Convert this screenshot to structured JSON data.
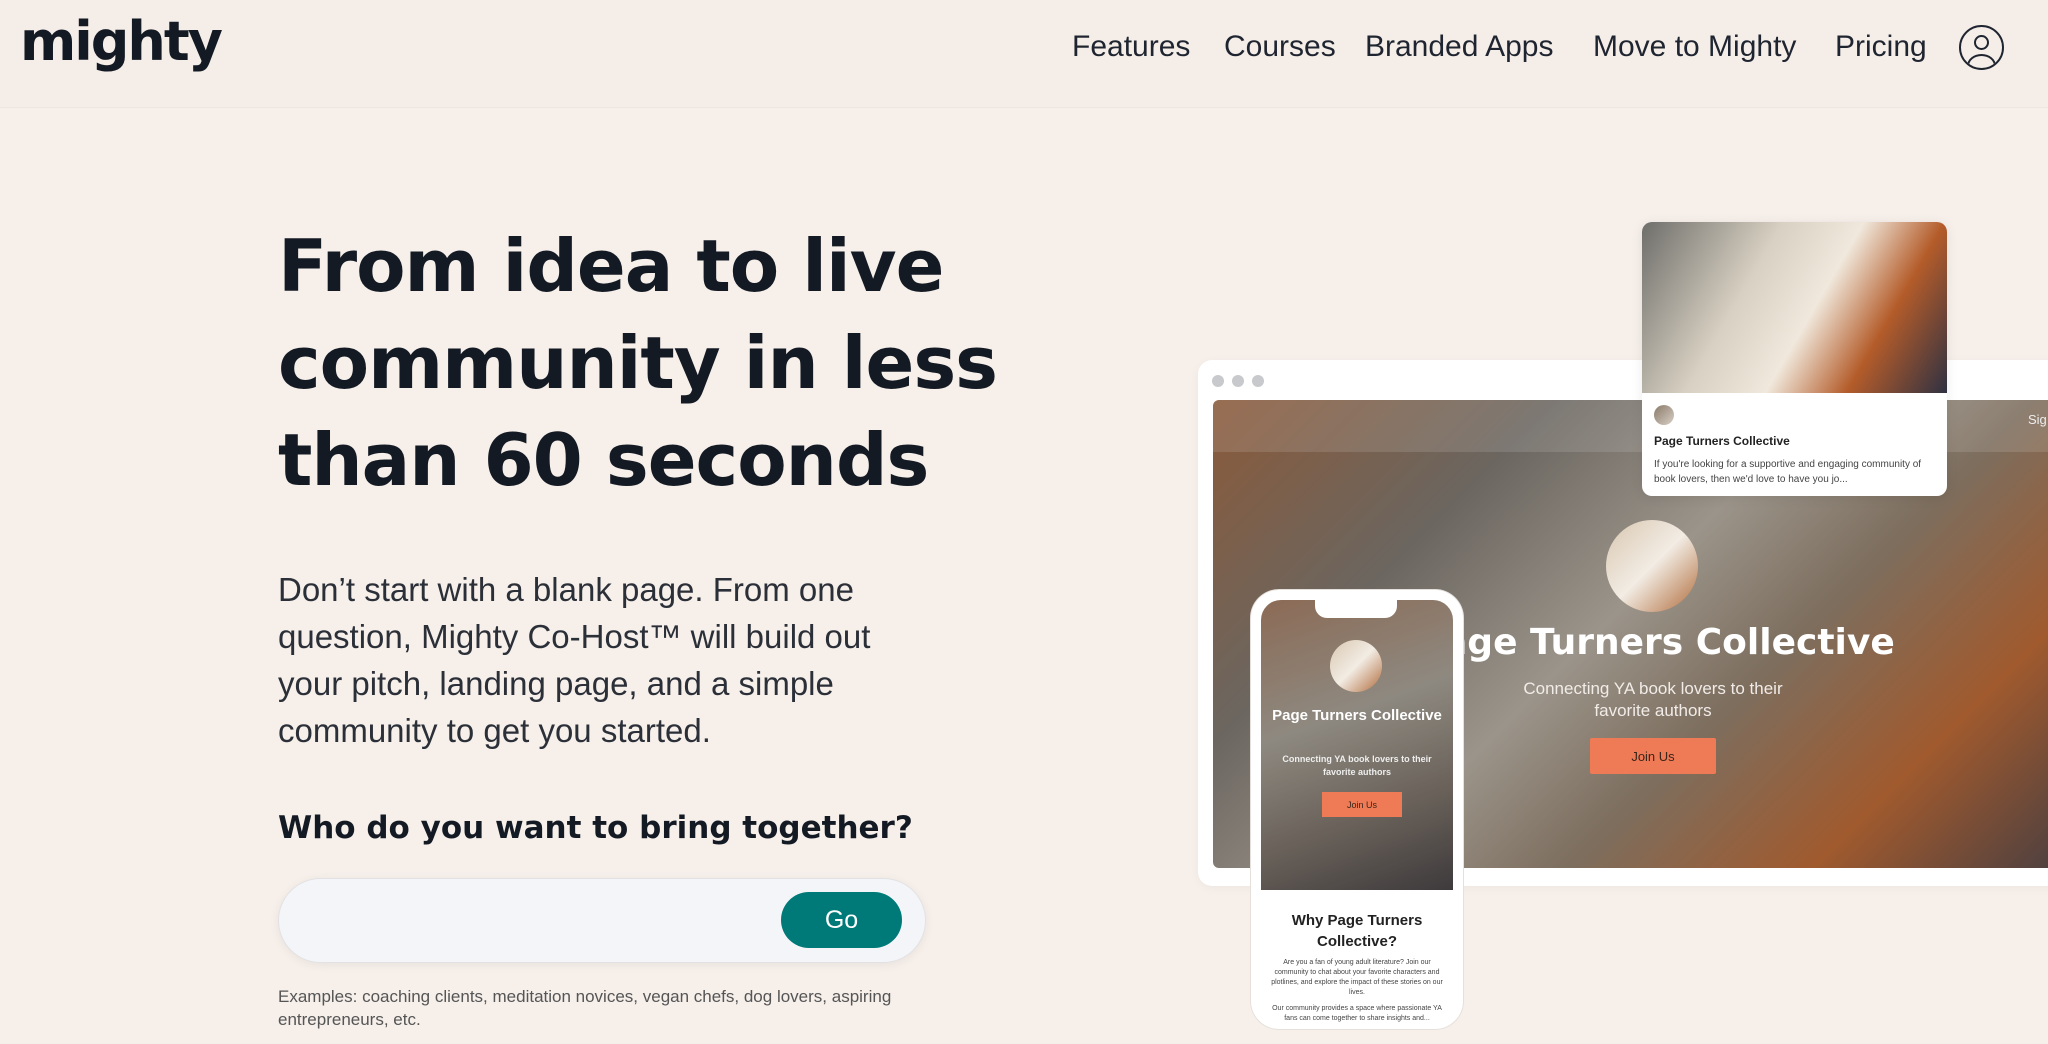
{
  "header": {
    "logo": "mighty",
    "nav": [
      "Features",
      "Courses",
      "Branded Apps",
      "Move to Mighty",
      "Pricing"
    ],
    "user_icon": "user-circle-icon"
  },
  "hero": {
    "title": "From idea to live community in less than 60 seconds",
    "lead": "Don’t start with a blank page. From one question, Mighty Co-Host™ will build out your pitch, landing page, and a simple community to get you started.",
    "question": "Who do you want to bring together?",
    "input_value": "",
    "go_label": "Go",
    "examples": "Examples: coaching clients, meditation novices, vegan chefs, dog lovers, aspiring entrepreneurs, etc."
  },
  "preview": {
    "desktop": {
      "title": "Page Turners Collective",
      "title_visible": "age Turners Collective",
      "subtitle": "Connecting YA book lovers to their favorite authors",
      "join": "Join Us",
      "sign": "Sig"
    },
    "card": {
      "name": "Page Turners Collective",
      "description": "If you're looking for a supportive and engaging community of book lovers, then we'd love to have you jo..."
    },
    "phone": {
      "title": "Page Turners Collective",
      "subtitle": "Connecting YA book lovers to their favorite authors",
      "join": "Join Us",
      "why": "Why Page Turners Collective?",
      "body": "Are you a fan of young adult literature? Join our community to chat about your favorite characters and plotlines, and explore the impact of these stories on our lives.",
      "body2": "Our community provides a space where passionate YA fans can come together to share insights and..."
    }
  },
  "colors": {
    "background": "#f6efea",
    "accent": "#007a78",
    "join_button": "#ef7b56"
  }
}
